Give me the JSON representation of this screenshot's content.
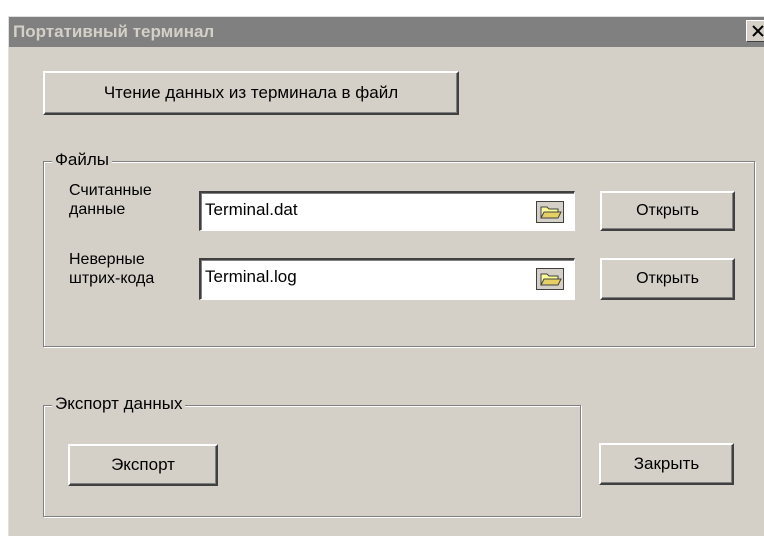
{
  "window": {
    "title": "Портативный терминал"
  },
  "buttons": {
    "read_data": "Чтение данных из терминала в файл",
    "open_1": "Открыть",
    "open_2": "Открыть",
    "export": "Экспорт",
    "close": "Закрыть"
  },
  "files_group": {
    "label": "Файлы",
    "read_data_label": "Считанные\nданные",
    "read_data_value": "Terminal.dat",
    "bad_barcodes_label": "Неверные\nштрих-кода",
    "bad_barcodes_value": "Terminal.log"
  },
  "export_group": {
    "label": "Экспорт данных"
  },
  "icons": {
    "close": "close-icon",
    "folder": "folder-icon"
  }
}
